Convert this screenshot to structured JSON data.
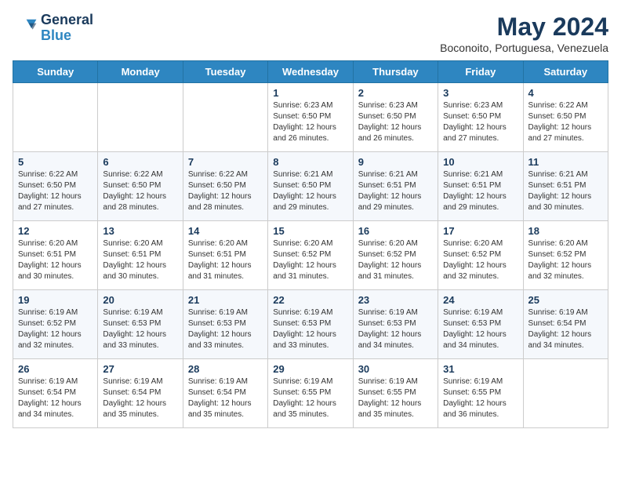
{
  "header": {
    "logo_line1": "General",
    "logo_line2": "Blue",
    "month_title": "May 2024",
    "subtitle": "Boconoito, Portuguesa, Venezuela"
  },
  "weekdays": [
    "Sunday",
    "Monday",
    "Tuesday",
    "Wednesday",
    "Thursday",
    "Friday",
    "Saturday"
  ],
  "weeks": [
    [
      {
        "day": "",
        "info": ""
      },
      {
        "day": "",
        "info": ""
      },
      {
        "day": "",
        "info": ""
      },
      {
        "day": "1",
        "info": "Sunrise: 6:23 AM\nSunset: 6:50 PM\nDaylight: 12 hours and 26 minutes."
      },
      {
        "day": "2",
        "info": "Sunrise: 6:23 AM\nSunset: 6:50 PM\nDaylight: 12 hours and 26 minutes."
      },
      {
        "day": "3",
        "info": "Sunrise: 6:23 AM\nSunset: 6:50 PM\nDaylight: 12 hours and 27 minutes."
      },
      {
        "day": "4",
        "info": "Sunrise: 6:22 AM\nSunset: 6:50 PM\nDaylight: 12 hours and 27 minutes."
      }
    ],
    [
      {
        "day": "5",
        "info": "Sunrise: 6:22 AM\nSunset: 6:50 PM\nDaylight: 12 hours and 27 minutes."
      },
      {
        "day": "6",
        "info": "Sunrise: 6:22 AM\nSunset: 6:50 PM\nDaylight: 12 hours and 28 minutes."
      },
      {
        "day": "7",
        "info": "Sunrise: 6:22 AM\nSunset: 6:50 PM\nDaylight: 12 hours and 28 minutes."
      },
      {
        "day": "8",
        "info": "Sunrise: 6:21 AM\nSunset: 6:50 PM\nDaylight: 12 hours and 29 minutes."
      },
      {
        "day": "9",
        "info": "Sunrise: 6:21 AM\nSunset: 6:51 PM\nDaylight: 12 hours and 29 minutes."
      },
      {
        "day": "10",
        "info": "Sunrise: 6:21 AM\nSunset: 6:51 PM\nDaylight: 12 hours and 29 minutes."
      },
      {
        "day": "11",
        "info": "Sunrise: 6:21 AM\nSunset: 6:51 PM\nDaylight: 12 hours and 30 minutes."
      }
    ],
    [
      {
        "day": "12",
        "info": "Sunrise: 6:20 AM\nSunset: 6:51 PM\nDaylight: 12 hours and 30 minutes."
      },
      {
        "day": "13",
        "info": "Sunrise: 6:20 AM\nSunset: 6:51 PM\nDaylight: 12 hours and 30 minutes."
      },
      {
        "day": "14",
        "info": "Sunrise: 6:20 AM\nSunset: 6:51 PM\nDaylight: 12 hours and 31 minutes."
      },
      {
        "day": "15",
        "info": "Sunrise: 6:20 AM\nSunset: 6:52 PM\nDaylight: 12 hours and 31 minutes."
      },
      {
        "day": "16",
        "info": "Sunrise: 6:20 AM\nSunset: 6:52 PM\nDaylight: 12 hours and 31 minutes."
      },
      {
        "day": "17",
        "info": "Sunrise: 6:20 AM\nSunset: 6:52 PM\nDaylight: 12 hours and 32 minutes."
      },
      {
        "day": "18",
        "info": "Sunrise: 6:20 AM\nSunset: 6:52 PM\nDaylight: 12 hours and 32 minutes."
      }
    ],
    [
      {
        "day": "19",
        "info": "Sunrise: 6:19 AM\nSunset: 6:52 PM\nDaylight: 12 hours and 32 minutes."
      },
      {
        "day": "20",
        "info": "Sunrise: 6:19 AM\nSunset: 6:53 PM\nDaylight: 12 hours and 33 minutes."
      },
      {
        "day": "21",
        "info": "Sunrise: 6:19 AM\nSunset: 6:53 PM\nDaylight: 12 hours and 33 minutes."
      },
      {
        "day": "22",
        "info": "Sunrise: 6:19 AM\nSunset: 6:53 PM\nDaylight: 12 hours and 33 minutes."
      },
      {
        "day": "23",
        "info": "Sunrise: 6:19 AM\nSunset: 6:53 PM\nDaylight: 12 hours and 34 minutes."
      },
      {
        "day": "24",
        "info": "Sunrise: 6:19 AM\nSunset: 6:53 PM\nDaylight: 12 hours and 34 minutes."
      },
      {
        "day": "25",
        "info": "Sunrise: 6:19 AM\nSunset: 6:54 PM\nDaylight: 12 hours and 34 minutes."
      }
    ],
    [
      {
        "day": "26",
        "info": "Sunrise: 6:19 AM\nSunset: 6:54 PM\nDaylight: 12 hours and 34 minutes."
      },
      {
        "day": "27",
        "info": "Sunrise: 6:19 AM\nSunset: 6:54 PM\nDaylight: 12 hours and 35 minutes."
      },
      {
        "day": "28",
        "info": "Sunrise: 6:19 AM\nSunset: 6:54 PM\nDaylight: 12 hours and 35 minutes."
      },
      {
        "day": "29",
        "info": "Sunrise: 6:19 AM\nSunset: 6:55 PM\nDaylight: 12 hours and 35 minutes."
      },
      {
        "day": "30",
        "info": "Sunrise: 6:19 AM\nSunset: 6:55 PM\nDaylight: 12 hours and 35 minutes."
      },
      {
        "day": "31",
        "info": "Sunrise: 6:19 AM\nSunset: 6:55 PM\nDaylight: 12 hours and 36 minutes."
      },
      {
        "day": "",
        "info": ""
      }
    ]
  ]
}
